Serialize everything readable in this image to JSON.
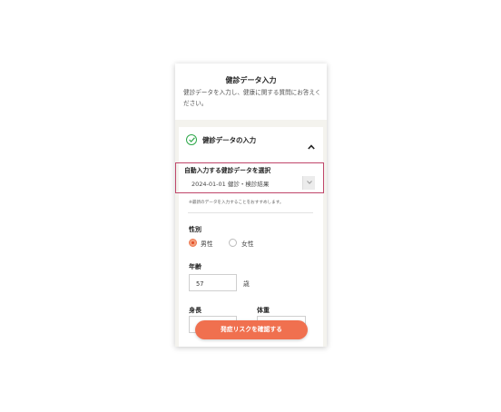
{
  "header": {
    "title": "健診データ入力",
    "description": "健診データを入力し、健康に関する質問にお答えください。"
  },
  "accordion": {
    "title": "健診データの入力",
    "check_icon": "check-circle-icon",
    "toggle_icon": "chevron-up-icon"
  },
  "auto_fill": {
    "label": "自動入力する健診データを選択",
    "selected": "2024-01-01 健診・検診結果",
    "note": "※最新のデータを入力することをおすすめします。"
  },
  "sex": {
    "label": "性別",
    "options": [
      "男性",
      "女性"
    ],
    "selected": "男性"
  },
  "age": {
    "label": "年齢",
    "value": "57",
    "unit": "歳"
  },
  "height": {
    "label": "身長"
  },
  "weight": {
    "label": "体重"
  },
  "cta": {
    "label": "発症リスクを確認する"
  },
  "colors": {
    "accent": "#f0704f",
    "check": "#2ea84a",
    "highlight": "#c0466a",
    "panel_bg": "#f4f3ee"
  }
}
